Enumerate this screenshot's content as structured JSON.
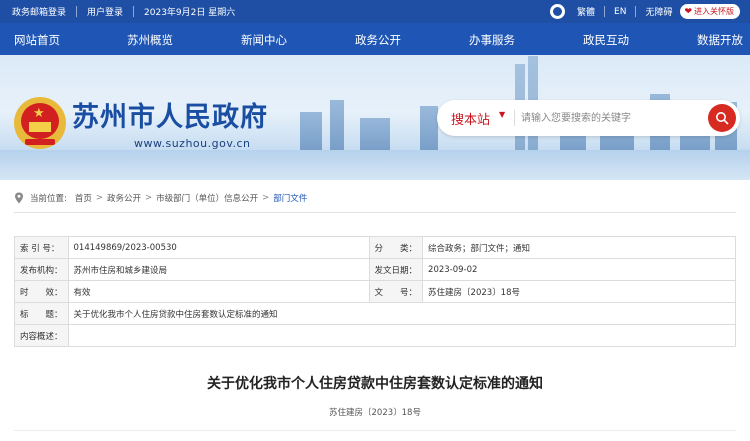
{
  "topbar": {
    "weibo": "政务邮箱登录",
    "user_login": "用户登录",
    "date": "2023年9月2日 星期六",
    "traditional": "繁體",
    "english": "EN",
    "accessibility": "无障碍",
    "care_mode": "进入关怀版"
  },
  "nav": {
    "items": [
      "网站首页",
      "苏州概览",
      "新闻中心",
      "政务公开",
      "办事服务",
      "政民互动",
      "数据开放"
    ]
  },
  "header": {
    "site_name": "苏州市人民政府",
    "site_url": "www.suzhou.gov.cn"
  },
  "search": {
    "scope": "搜本站",
    "placeholder": "请输入您要搜索的关键字"
  },
  "breadcrumb": {
    "label": "当前位置:",
    "items": [
      "首页",
      "政务公开",
      "市级部门（单位）信息公开",
      "部门文件"
    ]
  },
  "info": {
    "index_label": "索 引 号：",
    "index_value": "014149869/2023-00530",
    "category_label": "分　　类：",
    "category_value": "综合政务；部门文件；通知",
    "publisher_label": "发布机构：",
    "publisher_value": "苏州市住房和城乡建设局",
    "issue_date_label": "发文日期：",
    "issue_date_value": "2023-09-02",
    "validity_label": "时　　效：",
    "validity_value": "有效",
    "doc_no_label": "文　　号：",
    "doc_no_value": "苏住建房〔2023〕18号",
    "title_label": "标　　题：",
    "title_value": "关于优化我市个人住房贷款中住房套数认定标准的通知",
    "summary_label": "内容概述："
  },
  "document": {
    "title": "关于优化我市个人住房贷款中住房套数认定标准的通知",
    "number": "苏住建房〔2023〕18号"
  },
  "colors": {
    "topbar": "#1e4fa5",
    "nav": "#1f56b5",
    "accent_red": "#d72b22"
  }
}
